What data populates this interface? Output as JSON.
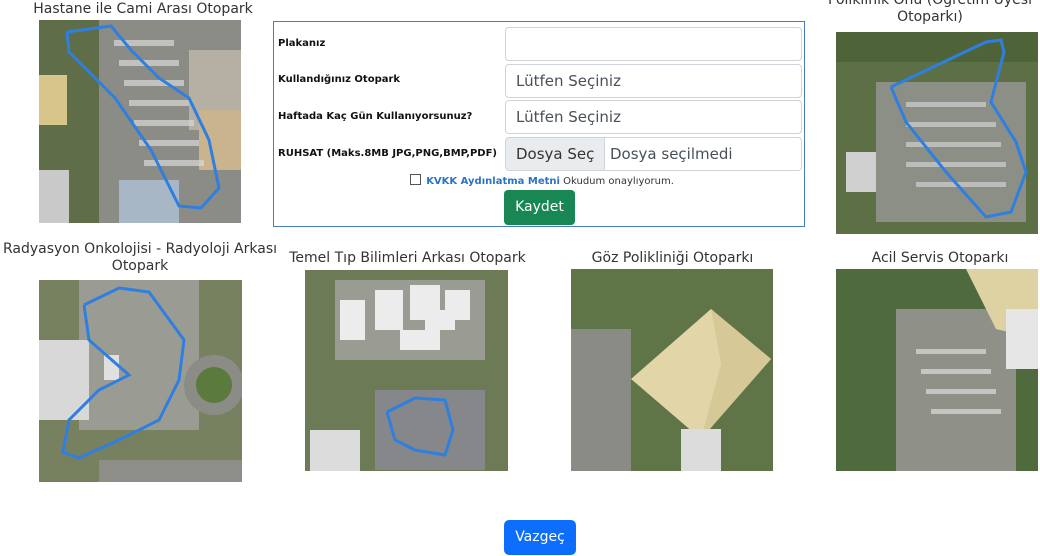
{
  "parking_lots": [
    {
      "caption": "Hastane ile Cami Arası Otopark"
    },
    {
      "caption": "Poliklinik Önü (Öğretim Üyesi Otoparkı)"
    },
    {
      "caption": "Radyasyon Onkolojisi - Radyoloji Arkası Otopark"
    },
    {
      "caption": "Temel Tıp Bilimleri Arkası Otopark"
    },
    {
      "caption": "Göz Polikliniği Otoparkı"
    },
    {
      "caption": "Acil Servis Otoparkı"
    }
  ],
  "form": {
    "plate_label": "Plakanız",
    "plate_value": "",
    "parking_label": "Kullandığınız Otopark",
    "parking_value": "Lütfen Seçiniz",
    "days_label": "Haftada Kaç Gün Kullanıyorsunuz?",
    "days_value": "Lütfen Seçiniz",
    "license_label": "RUHSAT (Maks.8MB JPG,PNG,BMP,PDF)",
    "file_button": "Dosya Seç",
    "file_status": "Dosya seçilmedi",
    "kvkk_link": "KVKK Aydınlatma Metni",
    "kvkk_text": "Okudum onaylıyorum.",
    "save_button": "Kaydet"
  },
  "cancel_button": "Vazgeç",
  "colors": {
    "route_outline": "#2f7fe0",
    "save_green": "#198754",
    "cancel_blue": "#0d6efd",
    "form_border": "#4a7bbd"
  }
}
